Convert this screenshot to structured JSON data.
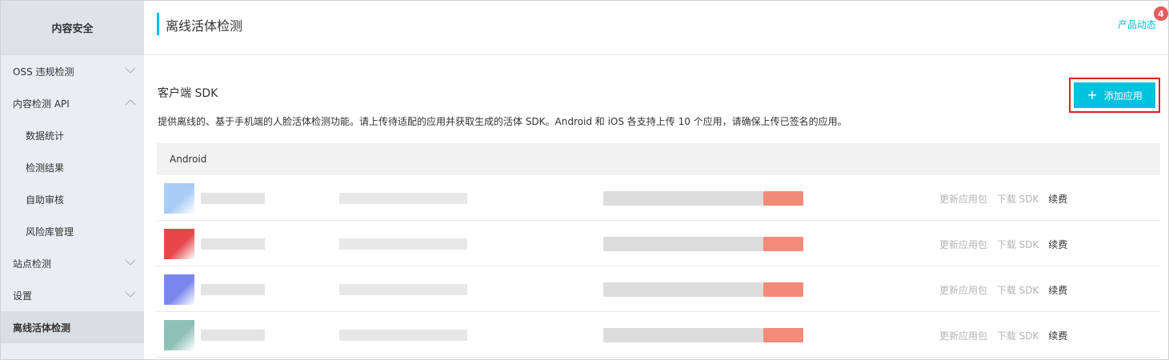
{
  "sidebar": {
    "title": "内容安全",
    "items": [
      {
        "label": "OSS 违规检测",
        "chevron": "down"
      },
      {
        "label": "内容检测 API",
        "chevron": "up"
      },
      {
        "label": "数据统计",
        "sub": true
      },
      {
        "label": "检测结果",
        "sub": true
      },
      {
        "label": "自助审核",
        "sub": true
      },
      {
        "label": "风险库管理",
        "sub": true
      },
      {
        "label": "站点检测",
        "chevron": "down"
      },
      {
        "label": "设置",
        "chevron": "down"
      },
      {
        "label": "离线活体检测",
        "active": true
      }
    ]
  },
  "header": {
    "title": "离线活体检测",
    "product_news": "产品动态",
    "badge_count": "4"
  },
  "section": {
    "title": "客户端 SDK",
    "description": "提供离线的、基于手机端的人脸活体检测功能。请上传待适配的应用并获取生成的活体 SDK。Android 和 iOS 各支持上传 10 个应用，请确保上传已签名的应用。",
    "add_button": "添加应用"
  },
  "table": {
    "platform_header": "Android",
    "rows": [
      {
        "icon_color": "#a8ccf5",
        "ops": {
          "update": "更新应用包",
          "download": "下载 SDK",
          "renew": "续费"
        }
      },
      {
        "icon_color": "#e8474a",
        "ops": {
          "update": "更新应用包",
          "download": "下载 SDK",
          "renew": "续费"
        }
      },
      {
        "icon_color": "#7b86ee",
        "ops": {
          "update": "更新应用包",
          "download": "下载 SDK",
          "renew": "续费"
        }
      },
      {
        "icon_color": "#8fc0b8",
        "ops": {
          "update": "更新应用包",
          "download": "下载 SDK",
          "renew": "续费"
        }
      }
    ]
  },
  "colors": {
    "accent": "#00c1de",
    "highlight_border": "#e02020",
    "badge": "#e45c5c"
  }
}
